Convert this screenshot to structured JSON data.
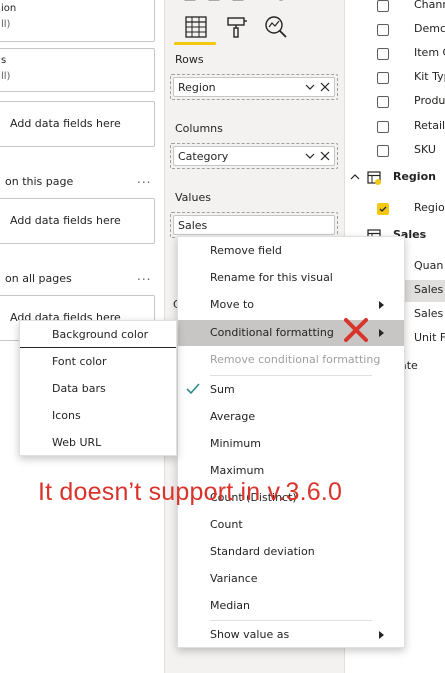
{
  "filters_pane": {
    "cards": [
      {
        "line1": "ion",
        "line2": "ll)"
      },
      {
        "line1": "s",
        "line2": "ll)"
      }
    ],
    "drop_placeholder": "Add data fields here",
    "sections": [
      {
        "title": "on this page",
        "more": "..."
      },
      {
        "title": "on all pages",
        "more": "..."
      }
    ]
  },
  "visualizations_pane": {
    "tool_icons": [
      "fields-icon",
      "format-paint-icon",
      "analytics-icon"
    ],
    "wells": [
      {
        "label": "Rows",
        "value": "Region"
      },
      {
        "label": "Columns",
        "value": "Category"
      },
      {
        "label": "Values",
        "value": "Sales"
      }
    ],
    "partial_label": "C"
  },
  "fields_pane": {
    "fields_top": [
      {
        "label": "Chann",
        "checked": false
      },
      {
        "label": "Demc",
        "checked": false
      },
      {
        "label": "Item C",
        "checked": false
      },
      {
        "label": "Kit Typ",
        "checked": false
      },
      {
        "label": "Produ",
        "checked": false
      },
      {
        "label": "Retail",
        "checked": false
      },
      {
        "label": "SKU",
        "checked": false
      }
    ],
    "tables": [
      {
        "label": "Region"
      },
      {
        "label": "Sales"
      }
    ],
    "region_fields": [
      {
        "label": "Regio",
        "checked": true
      }
    ],
    "sales_fields": [
      {
        "label": "Quan"
      },
      {
        "label": "Sales"
      },
      {
        "label": "Sales"
      },
      {
        "label": "Unit F"
      },
      {
        "label": "ate"
      }
    ]
  },
  "context_menu": {
    "items": [
      {
        "label": "Remove field",
        "arrow": false,
        "disabled": false,
        "highlight": false,
        "check": false
      },
      {
        "label": "Rename for this visual",
        "arrow": false,
        "disabled": false,
        "highlight": false,
        "check": false
      },
      {
        "label": "Move to",
        "arrow": true,
        "disabled": false,
        "highlight": false,
        "check": false
      },
      {
        "label": "Conditional formatting",
        "arrow": true,
        "disabled": false,
        "highlight": true,
        "check": false
      },
      {
        "label": "Remove conditional formatting",
        "arrow": false,
        "disabled": true,
        "highlight": false,
        "check": false
      },
      {
        "label": "Sum",
        "arrow": false,
        "disabled": false,
        "highlight": false,
        "check": true
      },
      {
        "label": "Average",
        "arrow": false,
        "disabled": false,
        "highlight": false,
        "check": false
      },
      {
        "label": "Minimum",
        "arrow": false,
        "disabled": false,
        "highlight": false,
        "check": false
      },
      {
        "label": "Maximum",
        "arrow": false,
        "disabled": false,
        "highlight": false,
        "check": false
      },
      {
        "label": "Count (Distinct)",
        "arrow": false,
        "disabled": false,
        "highlight": false,
        "check": false
      },
      {
        "label": "Count",
        "arrow": false,
        "disabled": false,
        "highlight": false,
        "check": false
      },
      {
        "label": "Standard deviation",
        "arrow": false,
        "disabled": false,
        "highlight": false,
        "check": false
      },
      {
        "label": "Variance",
        "arrow": false,
        "disabled": false,
        "highlight": false,
        "check": false
      },
      {
        "label": "Median",
        "arrow": false,
        "disabled": false,
        "highlight": false,
        "check": false
      },
      {
        "label": "Show value as",
        "arrow": true,
        "disabled": false,
        "highlight": false,
        "check": false
      }
    ]
  },
  "submenu": {
    "items": [
      "Background color",
      "Font color",
      "Data bars",
      "Icons",
      "Web URL"
    ]
  },
  "annotation": {
    "text": "It doesn’t support in v.3.6.0",
    "color": "#d9342b"
  },
  "colors": {
    "accent": "#f2c811",
    "highlight": "#c8c6c4",
    "check": "#2e8b8b",
    "error_x": "#d9342b"
  }
}
